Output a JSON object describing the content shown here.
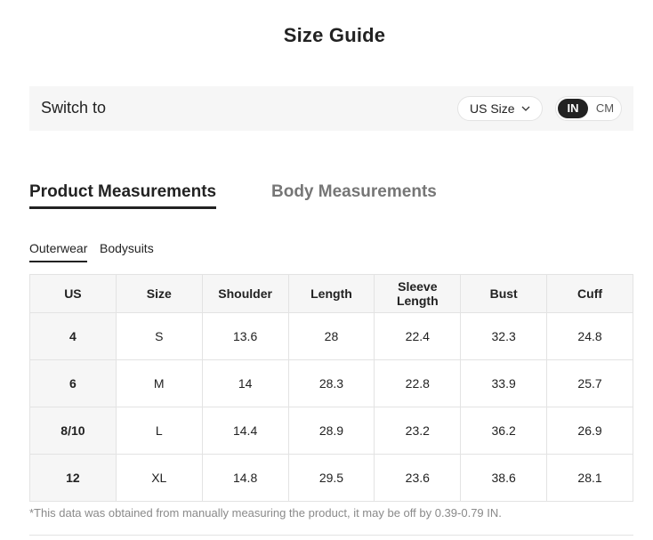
{
  "title": "Size Guide",
  "switch_bar": {
    "label": "Switch to",
    "size_select": "US Size",
    "units": {
      "in": "IN",
      "cm": "CM",
      "selected": "IN"
    }
  },
  "main_tabs": [
    {
      "label": "Product Measurements",
      "active": true
    },
    {
      "label": "Body Measurements",
      "active": false
    }
  ],
  "sub_tabs": [
    {
      "label": "Outerwear",
      "active": true
    },
    {
      "label": "Bodysuits",
      "active": false
    }
  ],
  "table": {
    "headers": [
      "US",
      "Size",
      "Shoulder",
      "Length",
      "Sleeve Length",
      "Bust",
      "Cuff"
    ],
    "rows": [
      [
        "4",
        "S",
        "13.6",
        "28",
        "22.4",
        "32.3",
        "24.8"
      ],
      [
        "6",
        "M",
        "14",
        "28.3",
        "22.8",
        "33.9",
        "25.7"
      ],
      [
        "8/10",
        "L",
        "14.4",
        "28.9",
        "23.2",
        "36.2",
        "26.9"
      ],
      [
        "12",
        "XL",
        "14.8",
        "29.5",
        "23.6",
        "38.6",
        "28.1"
      ]
    ]
  },
  "footnote": "*This data was obtained from manually measuring the product, it may be off by 0.39-0.79 IN."
}
